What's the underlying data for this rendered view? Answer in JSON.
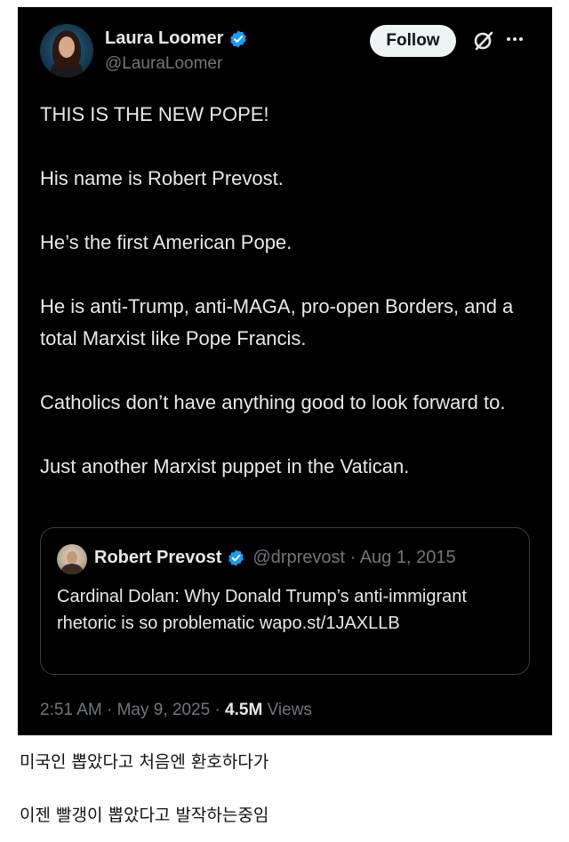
{
  "tweet": {
    "author": {
      "name": "Laura Loomer",
      "handle": "@LauraLoomer"
    },
    "follow_label": "Follow",
    "paragraphs": [
      "THIS IS THE NEW POPE!",
      "His name is Robert Prevost.",
      "He’s the first American Pope.",
      "He is anti-Trump, anti-MAGA, pro-open Borders, and a total Marxist like Pope Francis.",
      "Catholics don’t have anything good to look forward to.",
      "Just another Marxist puppet in the Vatican."
    ],
    "quoted": {
      "name": "Robert Prevost",
      "meta": "@drprevost · Aug 1, 2015",
      "text": "Cardinal Dolan: Why Donald Trump’s anti-immigrant rhetoric is so problematic wapo.st/1JAXLLB"
    },
    "timestamp": "2:51 AM · May 9, 2025 · ",
    "views_count": "4.5M",
    "views_label": " Views"
  },
  "captions": [
    "미국인 뽑았다고 처음엔 환호하다가",
    "이젠 빨갱이 뽑았다고 발작하는중임"
  ],
  "colors": {
    "tweet_bg": "#000000",
    "verified_blue": "#1d9bf0",
    "secondary_text": "#71767b"
  }
}
